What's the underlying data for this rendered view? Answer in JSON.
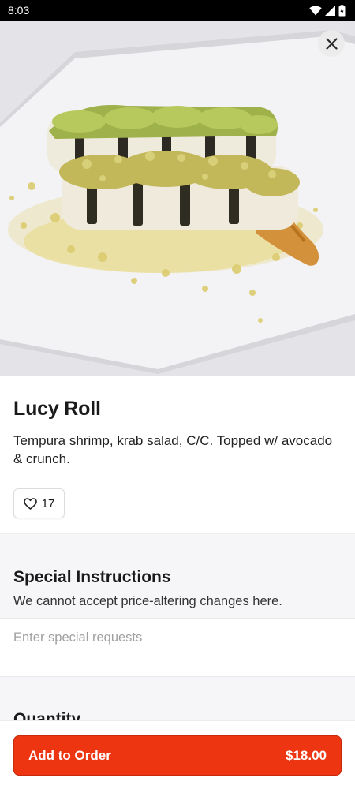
{
  "status_bar": {
    "time": "8:03"
  },
  "item": {
    "name": "Lucy Roll",
    "description": "Tempura shrimp, krab salad, C/C. Topped w/ avocado & crunch.",
    "likes": "17"
  },
  "special_instructions": {
    "title": "Special Instructions",
    "subtitle": "We cannot accept price-altering changes here.",
    "placeholder": "Enter special requests"
  },
  "quantity": {
    "title": "Quantity"
  },
  "order": {
    "button_label": "Add to Order",
    "price": "$18.00"
  },
  "colors": {
    "accent": "#ee3512"
  }
}
